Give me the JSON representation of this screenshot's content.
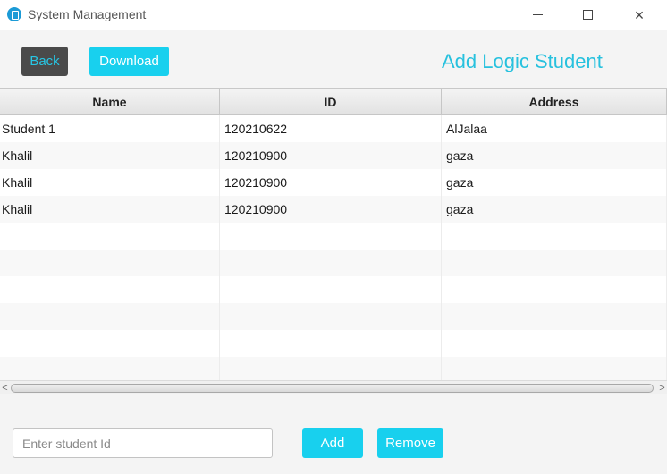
{
  "window": {
    "title": "System Management",
    "controls": {
      "minimize": "minimize",
      "maximize": "maximize",
      "close": "×"
    }
  },
  "toolbar": {
    "back_label": "Back",
    "download_label": "Download",
    "heading": "Add Logic Student"
  },
  "table": {
    "columns": [
      "Name",
      "ID",
      "Address"
    ],
    "rows": [
      {
        "name": "Student 1",
        "id": "120210622",
        "address": "AlJalaa"
      },
      {
        "name": "Khalil",
        "id": "120210900",
        "address": "gaza"
      },
      {
        "name": "Khalil",
        "id": "120210900",
        "address": "gaza"
      },
      {
        "name": "Khalil",
        "id": "120210900",
        "address": "gaza"
      },
      {
        "name": "",
        "id": "",
        "address": ""
      },
      {
        "name": "",
        "id": "",
        "address": ""
      },
      {
        "name": "",
        "id": "",
        "address": ""
      },
      {
        "name": "",
        "id": "",
        "address": ""
      },
      {
        "name": "",
        "id": "",
        "address": ""
      },
      {
        "name": "",
        "id": "",
        "address": ""
      }
    ]
  },
  "scrollbar": {
    "left_arrow": "<",
    "right_arrow": ">"
  },
  "form": {
    "student_id_value": "",
    "student_id_placeholder": "Enter student Id",
    "add_label": "Add",
    "remove_label": "Remove"
  },
  "colors": {
    "accent": "#18d0ee",
    "heading": "#27c1de",
    "back_button_bg": "#4a4a4a"
  }
}
